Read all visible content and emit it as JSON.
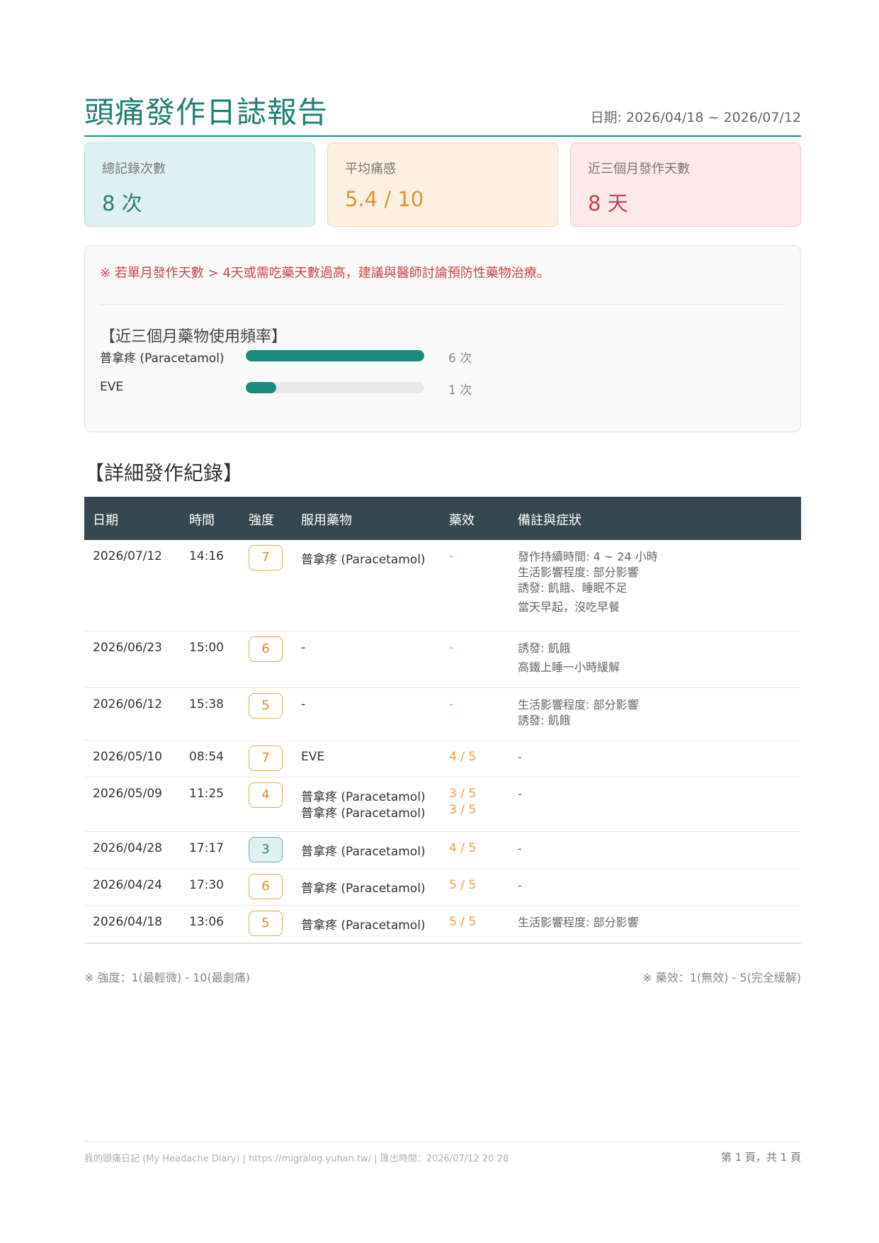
{
  "header": {
    "title": "頭痛發作日誌報告",
    "date_range": "日期: 2026/04/18 ~ 2026/07/12"
  },
  "stats": [
    {
      "label": "總記錄次數",
      "value": "8 次"
    },
    {
      "label": "平均痛感",
      "value": "5.4 / 10"
    },
    {
      "label": "近三個月發作天數",
      "value": "8 天"
    }
  ],
  "warning": "※ 若單月發作天數 > 4天或需吃藥天數過高，建議與醫師討論預防性藥物治療。",
  "med_frequency": {
    "title": "【近三個月藥物使用頻率】",
    "items": [
      {
        "name": "普拿疼 (Paracetamol)",
        "count": 6,
        "count_label": "6 次"
      },
      {
        "name": "EVE",
        "count": 1,
        "count_label": "1 次"
      }
    ]
  },
  "detail": {
    "title": "【詳細發作紀錄】",
    "columns": [
      "日期",
      "時間",
      "強度",
      "服用藥物",
      "藥效",
      "備註與症狀"
    ],
    "rows": [
      {
        "date": "2026/07/12",
        "time": "14:16",
        "intensity": "7",
        "meds": [
          "普拿疼 (Paracetamol)"
        ],
        "effects": [
          "-"
        ],
        "notes": [
          "發作持續時間: 4 ~ 24 小時",
          "生活影響程度: 部分影響",
          "誘發: 飢餓、睡眠不足",
          "當天早起，沒吃早餐"
        ]
      },
      {
        "date": "2026/06/23",
        "time": "15:00",
        "intensity": "6",
        "meds": [
          "-"
        ],
        "effects": [
          "-"
        ],
        "notes": [
          "誘發: 飢餓",
          "高鐵上睡一小時緩解"
        ]
      },
      {
        "date": "2026/06/12",
        "time": "15:38",
        "intensity": "5",
        "meds": [
          "-"
        ],
        "effects": [
          "-"
        ],
        "notes": [
          "生活影響程度: 部分影響",
          "誘發: 飢餓"
        ]
      },
      {
        "date": "2026/05/10",
        "time": "08:54",
        "intensity": "7",
        "meds": [
          "EVE"
        ],
        "effects": [
          "4 / 5"
        ],
        "notes": [
          "-"
        ]
      },
      {
        "date": "2026/05/09",
        "time": "11:25",
        "intensity": "4",
        "meds": [
          "普拿疼 (Paracetamol)",
          "普拿疼 (Paracetamol)"
        ],
        "effects": [
          "3 / 5",
          "3 / 5"
        ],
        "notes": [
          "-"
        ]
      },
      {
        "date": "2026/04/28",
        "time": "17:17",
        "intensity": "3",
        "meds": [
          "普拿疼 (Paracetamol)"
        ],
        "effects": [
          "4 / 5"
        ],
        "notes": [
          "-"
        ]
      },
      {
        "date": "2026/04/24",
        "time": "17:30",
        "intensity": "6",
        "meds": [
          "普拿疼 (Paracetamol)"
        ],
        "effects": [
          "5 / 5"
        ],
        "notes": [
          "-"
        ]
      },
      {
        "date": "2026/04/18",
        "time": "13:06",
        "intensity": "5",
        "meds": [
          "普拿疼 (Paracetamol)"
        ],
        "effects": [
          "5 / 5"
        ],
        "notes": [
          "生活影響程度: 部分影響"
        ]
      }
    ]
  },
  "legend": {
    "intensity": "※ 強度：1(最輕微) - 10(最劇痛)",
    "effect": "※ 藥效：1(無效) - 5(完全緩解)"
  },
  "footer": {
    "left": "我的頭痛日記 (My Headache Diary) | https://migralog.yuhan.tw/ | 匯出時間：2026/07/12 20:28",
    "right": "第 1 頁，共 1 頁"
  },
  "colors": {
    "accent": "#1a9283",
    "effect": "#e8a04a",
    "warning": "#c5474f",
    "table_header": "#37474f"
  }
}
